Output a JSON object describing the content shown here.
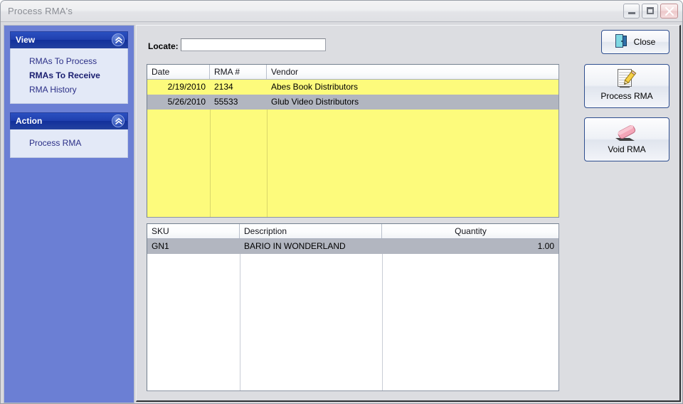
{
  "window": {
    "title": "Process RMA's",
    "controls": {
      "minimize": "Minimize",
      "maximize": "Maximize",
      "close": "Close"
    }
  },
  "sidebar": {
    "panels": [
      {
        "title": "View",
        "collapse_icon": "chevron-double-up-icon",
        "items": [
          {
            "label": "RMAs To Process",
            "selected": false
          },
          {
            "label": "RMAs To Receive",
            "selected": true
          },
          {
            "label": "RMA History",
            "selected": false
          }
        ]
      },
      {
        "title": "Action",
        "collapse_icon": "chevron-double-up-icon",
        "items": [
          {
            "label": "Process RMA",
            "selected": false
          }
        ]
      }
    ]
  },
  "toolbar": {
    "locate_label": "Locate:",
    "locate_value": "",
    "locate_placeholder": "",
    "close_label": "Close",
    "close_icon": "exit-door-icon"
  },
  "rma_grid": {
    "columns": [
      "Date",
      "RMA #",
      "Vendor"
    ],
    "sort_indicator": "sort-ascending-icon",
    "rows": [
      {
        "date": "2/19/2010",
        "rma": "2134",
        "vendor": "Abes Book Distributors",
        "state": "highlight"
      },
      {
        "date": "5/26/2010",
        "rma": "55533",
        "vendor": "Glub Video Distributors",
        "state": "selected"
      }
    ]
  },
  "items_grid": {
    "columns": [
      "SKU",
      "Description",
      "Quantity"
    ],
    "rows": [
      {
        "sku": "GN1",
        "description": "BARIO IN WONDERLAND",
        "quantity": "1.00",
        "state": "selected"
      }
    ]
  },
  "actions": [
    {
      "label": "Process RMA",
      "icon": "notepad-pencil-icon"
    },
    {
      "label": "Void RMA",
      "icon": "eraser-icon"
    }
  ],
  "colors": {
    "sidebar_blue": "#6b7fd4",
    "panel_header_blue": "#1f3fae",
    "row_highlight_yellow": "#fdfb7c",
    "row_selected_gray": "#b2b6c0",
    "content_gray": "#dcdde1"
  }
}
